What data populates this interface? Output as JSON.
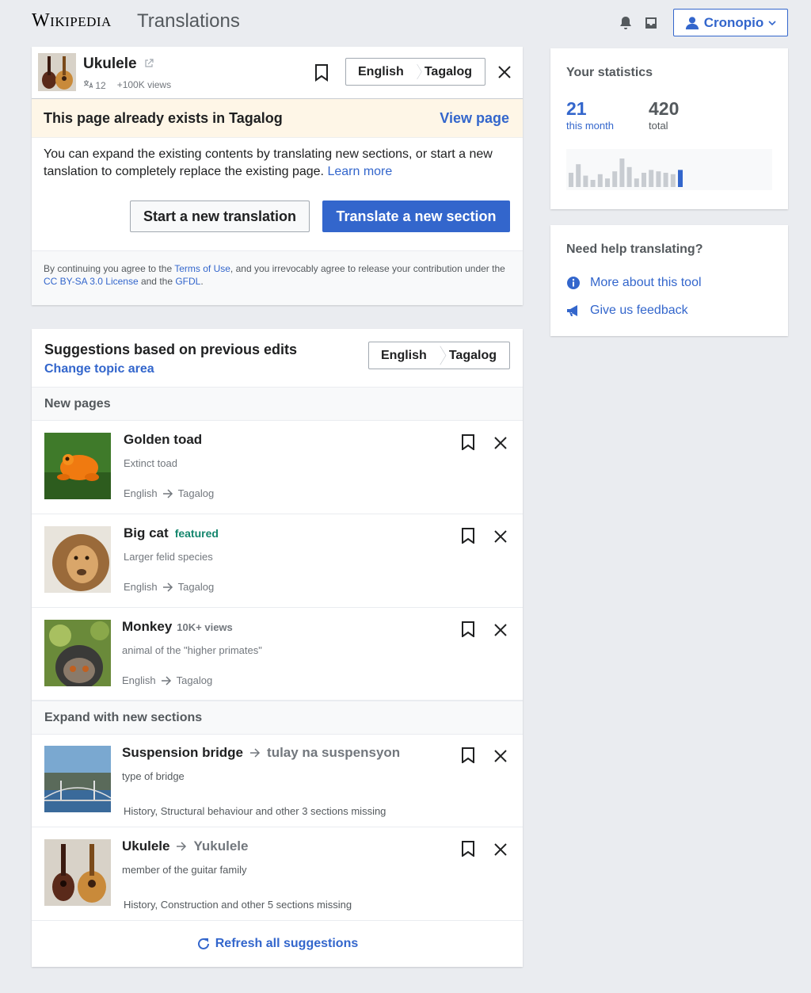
{
  "header": {
    "wordmark": "Wikipedia",
    "app_title": "Translations",
    "user_name": "Cronopio",
    "icons": [
      "bell-icon",
      "tray-icon",
      "user-icon",
      "chevron-down-icon"
    ]
  },
  "article": {
    "title": "Ukulele",
    "lang_count": "12",
    "views": "+100K views",
    "source_lang": "English",
    "target_lang": "Tagalog",
    "notice_title": "This page already exists in Tagalog",
    "notice_link": "View page",
    "body_text": "You can expand the existing contents by translating new sections, or start a new tanslation to completely replace the existing page.",
    "learn_more": "Learn more",
    "btn_new_translation": "Start a new translation",
    "btn_new_section": "Translate a new section",
    "legal": {
      "p1": "By continuing you agree to the ",
      "terms": "Terms of Use",
      "p2": ", and you irrevocably agree to release your contribution under the ",
      "license": "CC BY-SA 3.0 License",
      "p3": " and the ",
      "gfdl": "GFDL",
      "p4": "."
    }
  },
  "stats": {
    "heading": "Your statistics",
    "month_value": "21",
    "month_label": "this month",
    "total_value": "420",
    "total_label": "total",
    "bars": [
      0.5,
      0.8,
      0.4,
      0.25,
      0.45,
      0.3,
      0.55,
      1.0,
      0.7,
      0.3,
      0.5,
      0.6,
      0.55,
      0.5,
      0.45,
      0.6
    ],
    "bar_color": "#c8ccd1",
    "highlight_color": "#3366cc"
  },
  "help": {
    "heading": "Need help translating?",
    "links": [
      {
        "label": "More about this tool",
        "icon": "info-icon"
      },
      {
        "label": "Give us feedback",
        "icon": "megaphone-icon"
      }
    ]
  },
  "suggestions": {
    "heading": "Suggestions based on previous edits",
    "change_topic": "Change topic area",
    "source_lang": "English",
    "target_lang": "Tagalog",
    "new_pages_label": "New pages",
    "expand_label": "Expand with new sections",
    "new_pages": [
      {
        "title": "Golden toad",
        "desc": "Extinct toad",
        "src": "English",
        "tgt": "Tagalog"
      },
      {
        "title": "Big cat",
        "badge": "featured",
        "desc": "Larger felid species",
        "src": "English",
        "tgt": "Tagalog"
      },
      {
        "title": "Monkey",
        "badge": "10K+ views",
        "desc": "animal of the \"higher primates\"",
        "src": "English",
        "tgt": "Tagalog"
      }
    ],
    "sections": [
      {
        "title": "Suspension bridge",
        "target_title": "tulay na suspensyon",
        "desc": "type of bridge",
        "missing": "History, Structural behaviour and other 3 sections missing"
      },
      {
        "title": "Ukulele",
        "target_title": "Yukulele",
        "desc": "member of the guitar family",
        "missing": "History, Construction and other 5 sections missing"
      }
    ],
    "refresh": "Refresh all suggestions"
  }
}
